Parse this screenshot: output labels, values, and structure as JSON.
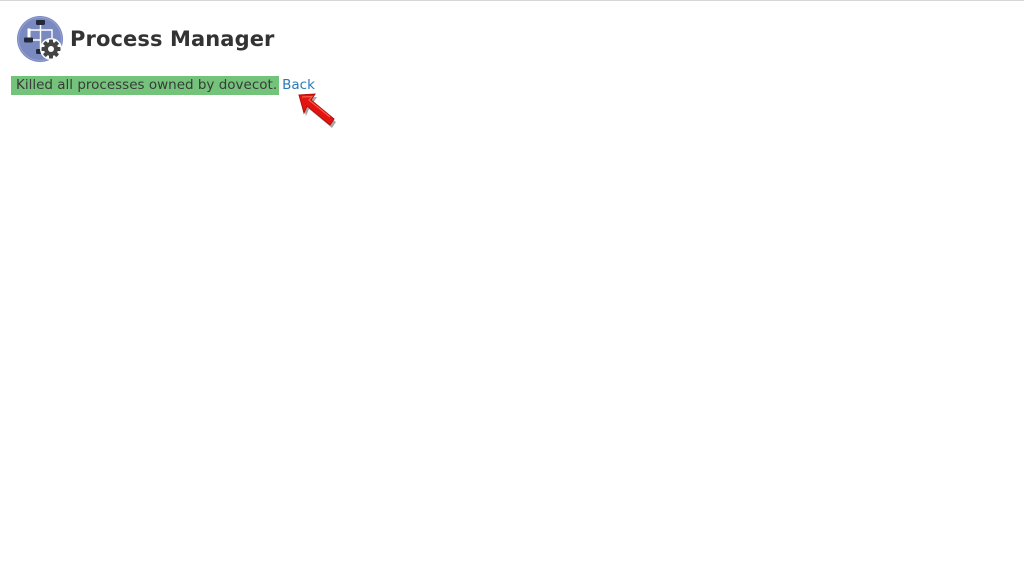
{
  "header": {
    "title": "Process Manager",
    "icon": "process-manager-icon"
  },
  "status": {
    "message": "Killed all processes owned by dovecot.",
    "back_label": "Back",
    "highlight_color": "#74c37a"
  },
  "annotation": {
    "icon": "red-arrow-icon",
    "color": "#e3140f"
  },
  "colors": {
    "link": "#2a7ab8",
    "title": "#333333",
    "icon_circle": "#7a8ac0"
  }
}
